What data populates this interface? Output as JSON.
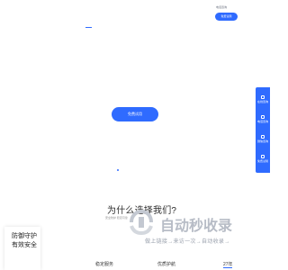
{
  "header": {
    "link_a": "电话咨询",
    "link_b": "免费试用"
  },
  "hero": {
    "cta_label": "免费试用"
  },
  "side_panel": {
    "items": [
      {
        "label": "在线咨询",
        "icon": "chat-icon"
      },
      {
        "label": "电话咨询",
        "icon": "phone-icon"
      },
      {
        "label": "微信咨询",
        "icon": "wechat-icon"
      },
      {
        "label": "免费试用",
        "icon": "trial-icon"
      }
    ]
  },
  "why": {
    "title": "为什么选择我们?",
    "subtitle": "安全防护 稳定可靠"
  },
  "watermark": {
    "title": "自动秒收录",
    "subtitle": "做上链接→来访一次→自动收录→"
  },
  "feature": {
    "line1": "防御守护",
    "line2": "有效安全"
  },
  "stats": [
    {
      "label": "稳定服务"
    },
    {
      "label": "优质护航"
    },
    {
      "label": "27年"
    }
  ],
  "colors": {
    "accent": "#2f6bff",
    "watermark": "#b7bcc6"
  }
}
